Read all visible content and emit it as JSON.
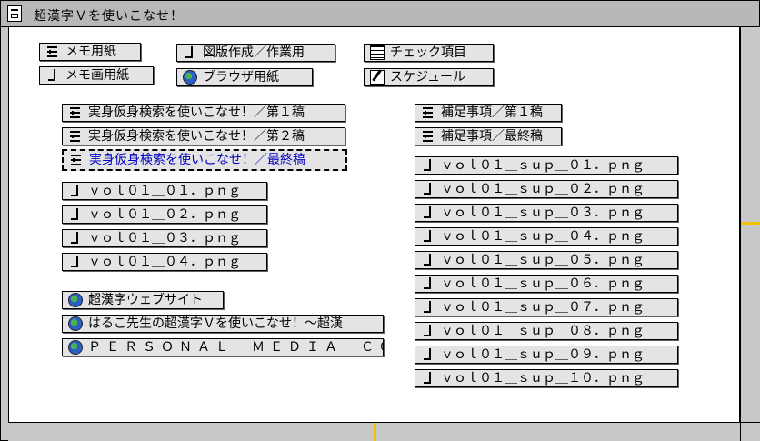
{
  "window": {
    "title": "超漢字Ｖを使いこなせ！"
  },
  "top_items": [
    {
      "label": "メモ用紙",
      "icon": "note-icon"
    },
    {
      "label": "メモ画用紙",
      "icon": "figure-icon"
    },
    {
      "label": "図版作成／作業用",
      "icon": "figure-icon"
    },
    {
      "label": "ブラウザ用紙",
      "icon": "browser-icon"
    },
    {
      "label": "チェック項目",
      "icon": "table-icon"
    },
    {
      "label": "スケジュール",
      "icon": "schedule-icon"
    }
  ],
  "drafts": [
    "実身仮身検索を使いこなせ！／第１稿",
    "実身仮身検索を使いこなせ！／第２稿",
    "実身仮身検索を使いこなせ！／最終稿"
  ],
  "pngs": [
    "ｖｏｌ０１＿０１．ｐｎｇ",
    "ｖｏｌ０１＿０２．ｐｎｇ",
    "ｖｏｌ０１＿０３．ｐｎｇ",
    "ｖｏｌ０１＿０４．ｐｎｇ"
  ],
  "links": [
    "超漢字ウェブサイト",
    "はるこ先生の超漢字Ｖを使いこなせ！～超漢",
    "ＰＥＲＳＯＮＡＬ　ＭＥＤＩＡ　ＣＯＲＰ．"
  ],
  "supplements": [
    "補足事項／第１稿",
    "補足事項／最終稿"
  ],
  "sup_pngs": [
    "ｖｏｌ０１＿ｓｕｐ＿０１．ｐｎｇ",
    "ｖｏｌ０１＿ｓｕｐ＿０２．ｐｎｇ",
    "ｖｏｌ０１＿ｓｕｐ＿０３．ｐｎｇ",
    "ｖｏｌ０１＿ｓｕｐ＿０４．ｐｎｇ",
    "ｖｏｌ０１＿ｓｕｐ＿０５．ｐｎｇ",
    "ｖｏｌ０１＿ｓｕｐ＿０６．ｐｎｇ",
    "ｖｏｌ０１＿ｓｕｐ＿０７．ｐｎｇ",
    "ｖｏｌ０１＿ｓｕｐ＿０８．ｐｎｇ",
    "ｖｏｌ０１＿ｓｕｐ＿０９．ｐｎｇ",
    "ｖｏｌ０１＿ｓｕｐ＿１０．ｐｎｇ"
  ],
  "colors": {
    "selected_text": "#0000c0",
    "scroll_thumb": "#f2c200"
  }
}
